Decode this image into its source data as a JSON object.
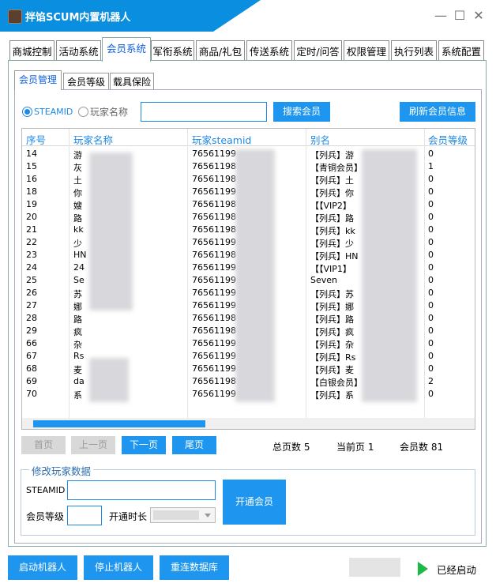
{
  "window": {
    "title": "拌馅SCUM内置机器人",
    "min_glyph": "—",
    "max_glyph": "☐",
    "close_glyph": "✕"
  },
  "main_tabs": [
    "商城控制",
    "活动系统",
    "会员系统",
    "军衔系统",
    "商品/礼包",
    "传送系统",
    "定时/问答",
    "权限管理",
    "执行列表",
    "系统配置"
  ],
  "sub_tabs": [
    "会员管理",
    "会员等级",
    "载具保险"
  ],
  "search": {
    "radio_steamid": "STEAMID",
    "radio_name": "玩家名称",
    "search_button": "搜索会员",
    "refresh_button": "刷新会员信息"
  },
  "table": {
    "columns": [
      "序号",
      "玩家名称",
      "玩家steamid",
      "别名",
      "会员等级"
    ],
    "rows": [
      {
        "id": "14",
        "name": "游",
        "steamid": "76561199",
        "alias": "【列兵】游",
        "level": "0"
      },
      {
        "id": "15",
        "name": "灰",
        "steamid": "76561198",
        "alias": "【青铜会员】",
        "level": "1"
      },
      {
        "id": "16",
        "name": "土",
        "steamid": "76561198",
        "alias": "【列兵】土",
        "level": "0"
      },
      {
        "id": "18",
        "name": "你",
        "steamid": "76561199",
        "alias": "【列兵】你",
        "level": "0"
      },
      {
        "id": "19",
        "name": "嫂",
        "steamid": "76561198",
        "alias": "【【VIP2】",
        "level": "0"
      },
      {
        "id": "20",
        "name": "路",
        "steamid": "76561198",
        "alias": "【列兵】路",
        "level": "0"
      },
      {
        "id": "21",
        "name": "kk",
        "steamid": "76561198",
        "alias": "【列兵】kk",
        "level": "0"
      },
      {
        "id": "22",
        "name": "少",
        "steamid": "76561199",
        "alias": "【列兵】少",
        "level": "0"
      },
      {
        "id": "23",
        "name": "HN",
        "steamid": "76561198",
        "alias": "【列兵】HN",
        "level": "0"
      },
      {
        "id": "24",
        "name": "24",
        "steamid": "76561199",
        "alias": "【【VIP1】",
        "level": "0"
      },
      {
        "id": "25",
        "name": "Se",
        "steamid": "76561199",
        "alias": "Seven",
        "level": "0"
      },
      {
        "id": "26",
        "name": "苏",
        "steamid": "76561199",
        "alias": "【列兵】苏",
        "level": "0"
      },
      {
        "id": "27",
        "name": "娜",
        "steamid": "76561199",
        "alias": "【列兵】娜",
        "level": "0"
      },
      {
        "id": "28",
        "name": "路",
        "steamid": "76561198",
        "alias": "【列兵】路",
        "level": "0"
      },
      {
        "id": "29",
        "name": "疯",
        "steamid": "76561198",
        "alias": "【列兵】疯",
        "level": "0"
      },
      {
        "id": "66",
        "name": "杂",
        "steamid": "76561199",
        "alias": "【列兵】杂",
        "level": "0"
      },
      {
        "id": "67",
        "name": "Rs",
        "steamid": "76561199",
        "alias": "【列兵】Rs",
        "level": "0"
      },
      {
        "id": "68",
        "name": "麦",
        "steamid": "76561199",
        "alias": "【列兵】麦",
        "level": "0"
      },
      {
        "id": "69",
        "name": "da",
        "steamid": "76561198",
        "alias": "【白银会员】",
        "level": "2"
      },
      {
        "id": "70",
        "name": "系",
        "steamid": "76561199",
        "alias": "【列兵】系",
        "level": "0"
      }
    ]
  },
  "pager": {
    "first": "首页",
    "prev": "上一页",
    "next": "下一页",
    "last": "尾页",
    "total_pages": "总页数 5",
    "current_page": "当前页 1",
    "member_count": "会员数 81"
  },
  "edit": {
    "title": "修改玩家数据",
    "steamid_label": "STEAMID",
    "level_label": "会员等级",
    "duration_label": "开通时长",
    "open_button": "开通会员"
  },
  "footer": {
    "start": "启动机器人",
    "stop": "停止机器人",
    "reconnect": "重连数据库",
    "status": "已经启动"
  }
}
